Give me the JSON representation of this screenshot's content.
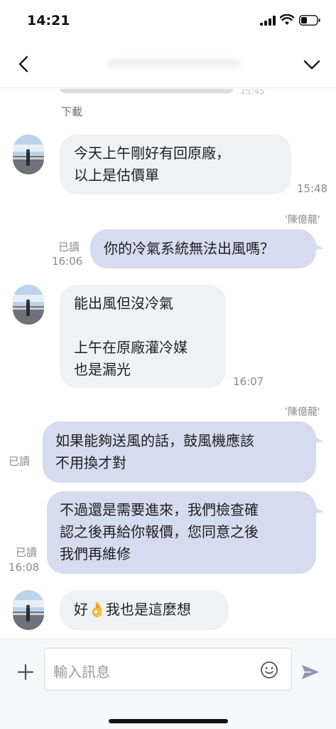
{
  "status_bar": {
    "time": "14:21"
  },
  "header": {
    "title": ""
  },
  "previous": {
    "time": "15:45",
    "download_label": "下載"
  },
  "messages": [
    {
      "id": "m1",
      "side": "in",
      "text": "今天上午剛好有回原廠，\n以上是估價單",
      "time": "15:48"
    },
    {
      "id": "m2",
      "side": "out",
      "sender": "'陳億龍'",
      "read": "已讀",
      "text": "你的冷氣系統無法出風嗎？",
      "time": "16:06"
    },
    {
      "id": "m3",
      "side": "in",
      "text": "能出風但沒冷氣\n\n上午在原廠灌冷媒\n也是漏光",
      "time": "16:07"
    },
    {
      "id": "m4",
      "side": "out",
      "sender": "'陳億龍'",
      "read": "已讀",
      "text": "如果能夠送風的話，鼓風機應該\n不用換才對",
      "time": ""
    },
    {
      "id": "m5",
      "side": "out",
      "read": "已讀",
      "text": "不過還是需要進來，我們檢查確\n認之後再給你報價，您同意之後\n我們再維修",
      "time": "16:08"
    },
    {
      "id": "m6",
      "side": "in",
      "text_before": "好",
      "emoji": "👌",
      "text_after": "我也是這麼想",
      "time": ""
    }
  ],
  "input": {
    "placeholder": "輸入訊息"
  },
  "icons": {
    "back": "back-icon",
    "menu": "chevron-down-icon",
    "add": "plus-icon",
    "emoji": "emoji-icon",
    "send": "send-icon"
  },
  "colors": {
    "incoming_bubble": "#eff1f4",
    "outgoing_bubble": "#d6dbf0",
    "send": "#8e95ad"
  }
}
